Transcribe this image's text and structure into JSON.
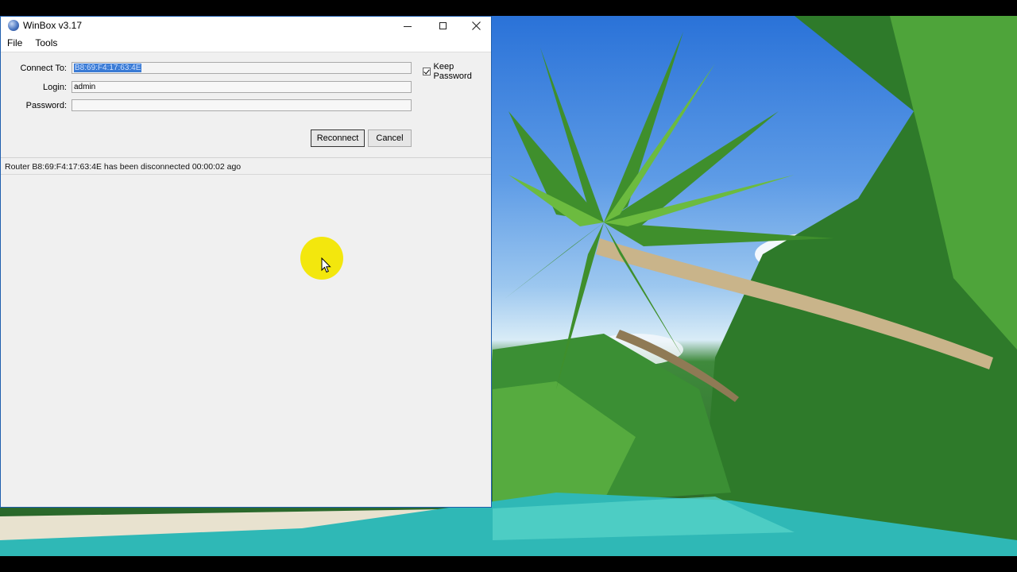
{
  "window": {
    "title": "WinBox v3.17",
    "controls": {
      "minimize": "minimize-icon",
      "maximize": "maximize-icon",
      "close": "close-icon"
    }
  },
  "menu": {
    "items": [
      "File",
      "Tools"
    ]
  },
  "form": {
    "connect_to_label": "Connect To:",
    "connect_to_value": "B8:69:F4:17:63:4E",
    "login_label": "Login:",
    "login_value": "admin",
    "password_label": "Password:",
    "password_value": "",
    "keep_password_label": "Keep Password",
    "keep_password_checked": true
  },
  "buttons": {
    "reconnect": "Reconnect",
    "cancel": "Cancel"
  },
  "status": {
    "message": "Router B8:69:F4:17:63:4E has been disconnected 00:00:02 ago"
  },
  "colors": {
    "selection": "#3a7bd5",
    "cursor_highlight": "#f2e600",
    "window_border": "#1f5fae"
  }
}
